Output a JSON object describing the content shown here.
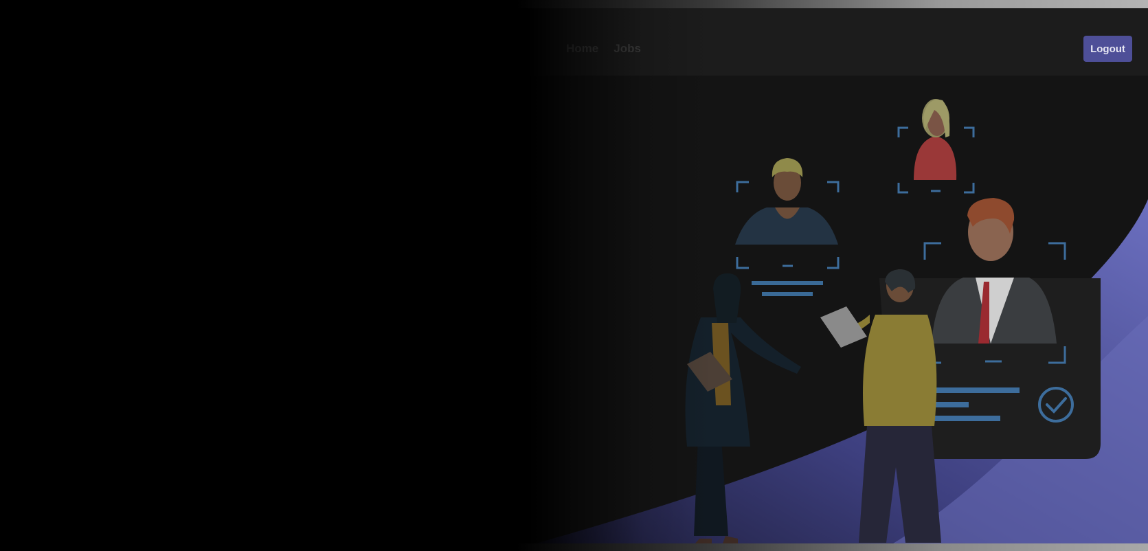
{
  "nav": {
    "links": [
      {
        "label": "Home"
      },
      {
        "label": "Jobs"
      }
    ],
    "logout_label": "Logout"
  },
  "hero": {
    "title": ""
  },
  "colors": {
    "accent": "#4e4f98",
    "illustration_purple": "#6467b4",
    "background": "#141414"
  },
  "icons": [
    "check-circle-icon"
  ]
}
